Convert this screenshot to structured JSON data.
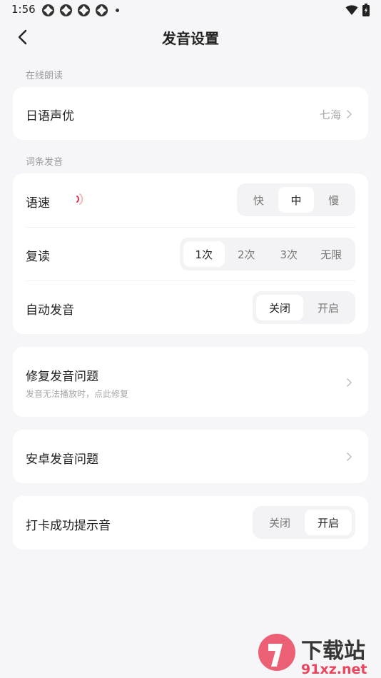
{
  "status": {
    "time": "1:56"
  },
  "header": {
    "title": "发音设置"
  },
  "online": {
    "section_label": "在线朗读",
    "voice": {
      "title": "日语声优",
      "value": "七海"
    }
  },
  "entry": {
    "section_label": "词条发音",
    "speed": {
      "title": "语速",
      "options": [
        "快",
        "中",
        "慢"
      ],
      "selected": 1
    },
    "repeat": {
      "title": "复读",
      "options": [
        "1次",
        "2次",
        "3次",
        "无限"
      ],
      "selected": 0
    },
    "auto": {
      "title": "自动发音",
      "options": [
        "关闭",
        "开启"
      ],
      "selected": 0
    }
  },
  "fix": {
    "title": "修复发音问题",
    "subtitle": "发音无法播放时，点此修复"
  },
  "android": {
    "title": "安卓发音问题"
  },
  "checkin": {
    "title": "打卡成功提示音",
    "options": [
      "关闭",
      "开启"
    ],
    "selected": 1
  },
  "watermark": {
    "text": "下载站",
    "domain": "91xz.net"
  },
  "colors": {
    "accent": "#e8334e",
    "background": "#f6f6f8",
    "card": "#ffffff"
  }
}
